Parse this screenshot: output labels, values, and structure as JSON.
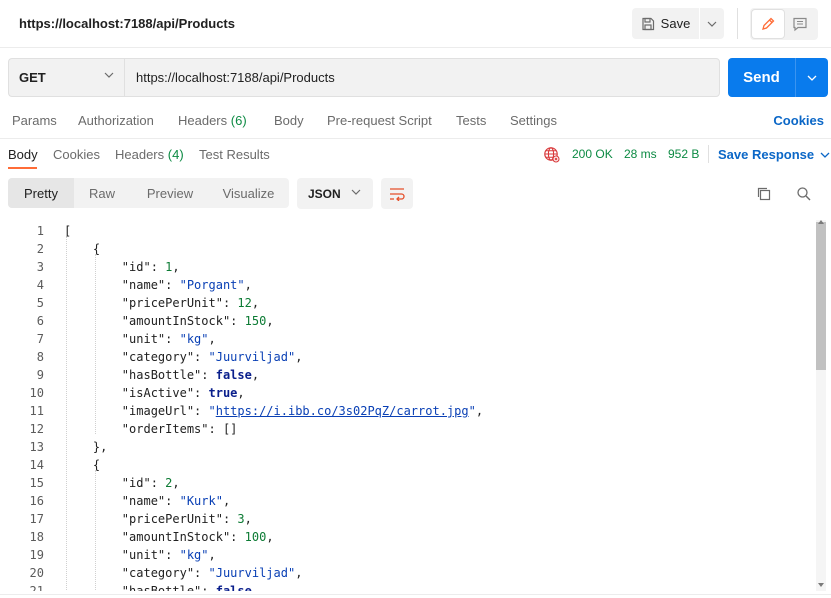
{
  "header": {
    "title": "https://localhost:7188/api/Products",
    "save_label": "Save",
    "save_icon": "save-icon",
    "edit_icon": "pencil-icon",
    "comment_icon": "comment-icon"
  },
  "request": {
    "method": "GET",
    "url": "https://localhost:7188/api/Products",
    "send_label": "Send"
  },
  "request_tabs": {
    "params": "Params",
    "authorization": "Authorization",
    "headers": "Headers",
    "headers_count": "(6)",
    "body": "Body",
    "prerequest": "Pre-request Script",
    "tests": "Tests",
    "settings": "Settings",
    "cookies": "Cookies"
  },
  "response_tabs": {
    "body": "Body",
    "cookies": "Cookies",
    "headers": "Headers",
    "headers_count": "(4)",
    "test_results": "Test Results",
    "status": "200 OK",
    "time": "28 ms",
    "size": "952 B",
    "save_response": "Save Response"
  },
  "format": {
    "pretty": "Pretty",
    "raw": "Raw",
    "preview": "Preview",
    "visualize": "Visualize",
    "language": "JSON"
  },
  "colors": {
    "accent_blue": "#097bed",
    "link_blue": "#0b67c7",
    "status_green": "#0c8a43",
    "tab_orange": "#ff6c37",
    "string_blue": "#0a40b5",
    "number_green": "#0c7b34"
  },
  "code_lines": [
    {
      "n": "1",
      "t": [
        [
          "p",
          "["
        ]
      ]
    },
    {
      "n": "2",
      "t": [
        [
          "p",
          "    {"
        ]
      ]
    },
    {
      "n": "3",
      "t": [
        [
          "p",
          "        "
        ],
        [
          "k",
          "\"id\""
        ],
        [
          "p",
          ": "
        ],
        [
          "n",
          "1"
        ],
        [
          "p",
          ","
        ]
      ]
    },
    {
      "n": "4",
      "t": [
        [
          "p",
          "        "
        ],
        [
          "k",
          "\"name\""
        ],
        [
          "p",
          ": "
        ],
        [
          "s",
          "\"Porgant\""
        ],
        [
          "p",
          ","
        ]
      ]
    },
    {
      "n": "5",
      "t": [
        [
          "p",
          "        "
        ],
        [
          "k",
          "\"pricePerUnit\""
        ],
        [
          "p",
          ": "
        ],
        [
          "n",
          "12"
        ],
        [
          "p",
          ","
        ]
      ]
    },
    {
      "n": "6",
      "t": [
        [
          "p",
          "        "
        ],
        [
          "k",
          "\"amountInStock\""
        ],
        [
          "p",
          ": "
        ],
        [
          "n",
          "150"
        ],
        [
          "p",
          ","
        ]
      ]
    },
    {
      "n": "7",
      "t": [
        [
          "p",
          "        "
        ],
        [
          "k",
          "\"unit\""
        ],
        [
          "p",
          ": "
        ],
        [
          "s",
          "\"kg\""
        ],
        [
          "p",
          ","
        ]
      ]
    },
    {
      "n": "8",
      "t": [
        [
          "p",
          "        "
        ],
        [
          "k",
          "\"category\""
        ],
        [
          "p",
          ": "
        ],
        [
          "s",
          "\"Juurviljad\""
        ],
        [
          "p",
          ","
        ]
      ]
    },
    {
      "n": "9",
      "t": [
        [
          "p",
          "        "
        ],
        [
          "k",
          "\"hasBottle\""
        ],
        [
          "p",
          ": "
        ],
        [
          "b",
          "false"
        ],
        [
          "p",
          ","
        ]
      ]
    },
    {
      "n": "10",
      "t": [
        [
          "p",
          "        "
        ],
        [
          "k",
          "\"isActive\""
        ],
        [
          "p",
          ": "
        ],
        [
          "b",
          "true"
        ],
        [
          "p",
          ","
        ]
      ]
    },
    {
      "n": "11",
      "t": [
        [
          "p",
          "        "
        ],
        [
          "k",
          "\"imageUrl\""
        ],
        [
          "p",
          ": "
        ],
        [
          "s",
          "\""
        ],
        [
          "u",
          "https://i.ibb.co/3s02PqZ/carrot.jpg"
        ],
        [
          "s",
          "\""
        ],
        [
          "p",
          ","
        ]
      ]
    },
    {
      "n": "12",
      "t": [
        [
          "p",
          "        "
        ],
        [
          "k",
          "\"orderItems\""
        ],
        [
          "p",
          ": []"
        ]
      ]
    },
    {
      "n": "13",
      "t": [
        [
          "p",
          "    },"
        ]
      ]
    },
    {
      "n": "14",
      "t": [
        [
          "p",
          "    {"
        ]
      ]
    },
    {
      "n": "15",
      "t": [
        [
          "p",
          "        "
        ],
        [
          "k",
          "\"id\""
        ],
        [
          "p",
          ": "
        ],
        [
          "n",
          "2"
        ],
        [
          "p",
          ","
        ]
      ]
    },
    {
      "n": "16",
      "t": [
        [
          "p",
          "        "
        ],
        [
          "k",
          "\"name\""
        ],
        [
          "p",
          ": "
        ],
        [
          "s",
          "\"Kurk\""
        ],
        [
          "p",
          ","
        ]
      ]
    },
    {
      "n": "17",
      "t": [
        [
          "p",
          "        "
        ],
        [
          "k",
          "\"pricePerUnit\""
        ],
        [
          "p",
          ": "
        ],
        [
          "n",
          "3"
        ],
        [
          "p",
          ","
        ]
      ]
    },
    {
      "n": "18",
      "t": [
        [
          "p",
          "        "
        ],
        [
          "k",
          "\"amountInStock\""
        ],
        [
          "p",
          ": "
        ],
        [
          "n",
          "100"
        ],
        [
          "p",
          ","
        ]
      ]
    },
    {
      "n": "19",
      "t": [
        [
          "p",
          "        "
        ],
        [
          "k",
          "\"unit\""
        ],
        [
          "p",
          ": "
        ],
        [
          "s",
          "\"kg\""
        ],
        [
          "p",
          ","
        ]
      ]
    },
    {
      "n": "20",
      "t": [
        [
          "p",
          "        "
        ],
        [
          "k",
          "\"category\""
        ],
        [
          "p",
          ": "
        ],
        [
          "s",
          "\"Juurviljad\""
        ],
        [
          "p",
          ","
        ]
      ]
    },
    {
      "n": "21",
      "t": [
        [
          "p",
          "        "
        ],
        [
          "k",
          "\"hasBottle\""
        ],
        [
          "p",
          ": "
        ],
        [
          "b",
          "false"
        ],
        [
          "p",
          ","
        ]
      ]
    }
  ]
}
